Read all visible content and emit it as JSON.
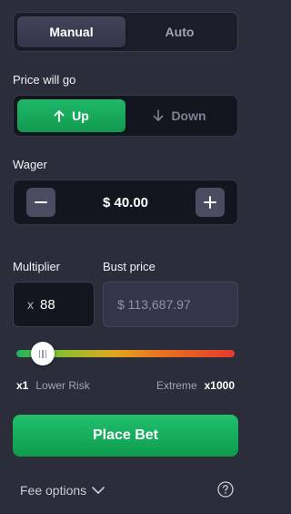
{
  "mode_tabs": [
    {
      "label": "Manual",
      "active": true
    },
    {
      "label": "Auto",
      "active": false
    }
  ],
  "direction": {
    "label": "Price will go",
    "up_label": "Up",
    "down_label": "Down",
    "selected": "Up"
  },
  "wager": {
    "label": "Wager",
    "value": "$ 40.00"
  },
  "multiplier": {
    "label": "Multiplier",
    "prefix": "x",
    "value": "88"
  },
  "bust_price": {
    "label": "Bust price",
    "value": "$ 113,687.97"
  },
  "risk_slider": {
    "min_value": "x1",
    "min_label": "Lower Risk",
    "max_label": "Extreme",
    "max_value": "x1000",
    "position_fraction": 0.12
  },
  "place_bet_label": "Place Bet",
  "fee_options_label": "Fee options",
  "icons": [
    "arrow-up-icon",
    "arrow-down-icon",
    "minus-icon",
    "plus-icon",
    "chevron-down-icon",
    "help-icon"
  ],
  "colors": {
    "accent_green": "#16a85b",
    "background": "#2b2d3b"
  }
}
